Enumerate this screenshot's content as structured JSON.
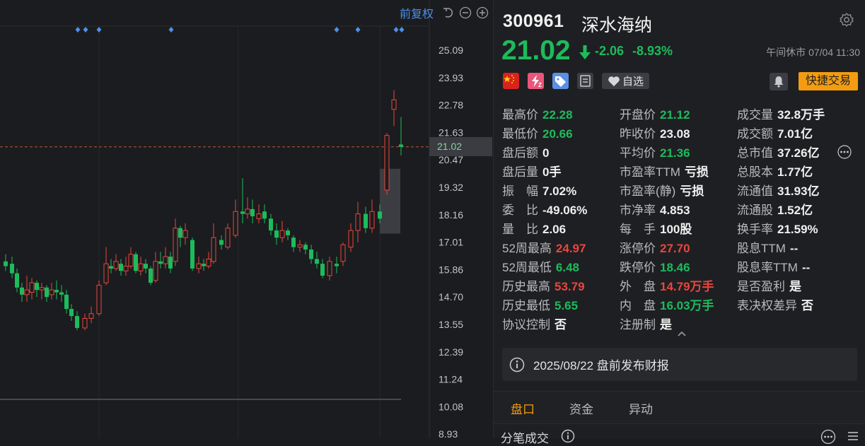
{
  "chart": {
    "adjust_label": "前复权",
    "y_ticks": [
      "25.09",
      "23.93",
      "22.78",
      "21.63",
      "20.47",
      "19.32",
      "18.16",
      "17.01",
      "15.86",
      "14.70",
      "13.55",
      "12.39",
      "11.24",
      "10.08",
      "8.93"
    ],
    "current_price_label": "21.02",
    "colors": {
      "up": "#e8463d",
      "down": "#1dbb5c",
      "marker": "#4e8fe8",
      "dashed": "#c0582f"
    }
  },
  "quote": {
    "code": "300961",
    "name": "深水海纳",
    "price": "21.02",
    "change": "-2.06",
    "change_pct": "-8.93%",
    "market_status": "午间休市 07/04 11:30",
    "watch_label": "自选",
    "trade_label": "快捷交易",
    "stats": [
      {
        "label": "最高价",
        "value": "22.28",
        "color": "green"
      },
      {
        "label": "开盘价",
        "value": "21.12",
        "color": "green"
      },
      {
        "label": "成交量",
        "value": "32.8万手",
        "color": "white"
      },
      {
        "label": "最低价",
        "value": "20.66",
        "color": "green"
      },
      {
        "label": "昨收价",
        "value": "23.08",
        "color": "white"
      },
      {
        "label": "成交额",
        "value": "7.01亿",
        "color": "white"
      },
      {
        "label": "盘后额",
        "value": "0",
        "color": "white"
      },
      {
        "label": "平均价",
        "value": "21.36",
        "color": "green"
      },
      {
        "label": "总市值",
        "value": "37.26亿",
        "color": "white"
      },
      {
        "label": "盘后量",
        "value": "0手",
        "color": "white"
      },
      {
        "label": "市盈率TTM",
        "value": "亏损",
        "color": "white"
      },
      {
        "label": "总股本",
        "value": "1.77亿",
        "color": "white"
      },
      {
        "label": "振　幅",
        "value": "7.02%",
        "color": "white"
      },
      {
        "label": "市盈率(静)",
        "value": "亏损",
        "color": "white"
      },
      {
        "label": "流通值",
        "value": "31.93亿",
        "color": "white"
      },
      {
        "label": "委　比",
        "value": "-49.06%",
        "color": "white"
      },
      {
        "label": "市净率",
        "value": "4.853",
        "color": "white"
      },
      {
        "label": "流通股",
        "value": "1.52亿",
        "color": "white"
      },
      {
        "label": "量　比",
        "value": "2.06",
        "color": "white"
      },
      {
        "label": "每　手",
        "value": "100股",
        "color": "white"
      },
      {
        "label": "换手率",
        "value": "21.59%",
        "color": "white"
      },
      {
        "label": "52周最高",
        "value": "24.97",
        "color": "red"
      },
      {
        "label": "涨停价",
        "value": "27.70",
        "color": "red"
      },
      {
        "label": "股息TTM",
        "value": "--",
        "color": "white"
      },
      {
        "label": "52周最低",
        "value": "6.48",
        "color": "green"
      },
      {
        "label": "跌停价",
        "value": "18.46",
        "color": "green"
      },
      {
        "label": "股息率TTM",
        "value": "--",
        "color": "white"
      },
      {
        "label": "历史最高",
        "value": "53.79",
        "color": "red"
      },
      {
        "label": "外　盘",
        "value": "14.79万手",
        "color": "red"
      },
      {
        "label": "是否盈利",
        "value": "是",
        "color": "white"
      },
      {
        "label": "历史最低",
        "value": "5.65",
        "color": "green"
      },
      {
        "label": "内　盘",
        "value": "16.03万手",
        "color": "green"
      },
      {
        "label": "表决权差异",
        "value": "否",
        "color": "white"
      },
      {
        "label": "协议控制",
        "value": "否",
        "color": "white"
      },
      {
        "label": "注册制",
        "value": "是",
        "color": "white"
      }
    ],
    "notice": "2025/08/22  盘前发布财报",
    "tabs": [
      "盘口",
      "资金",
      "异动"
    ],
    "active_tab": "盘口",
    "subheader": "分笔成交"
  },
  "icons": [
    "undo-icon",
    "zoom-out-icon",
    "zoom-in-icon",
    "settings-icon",
    "down-arrow-icon",
    "china-flag-icon",
    "margin-trading-icon",
    "tag-icon",
    "notebook-icon",
    "heart-icon",
    "bell-icon",
    "more-icon",
    "collapse-chevron-icon",
    "info-icon",
    "list-icon"
  ]
}
